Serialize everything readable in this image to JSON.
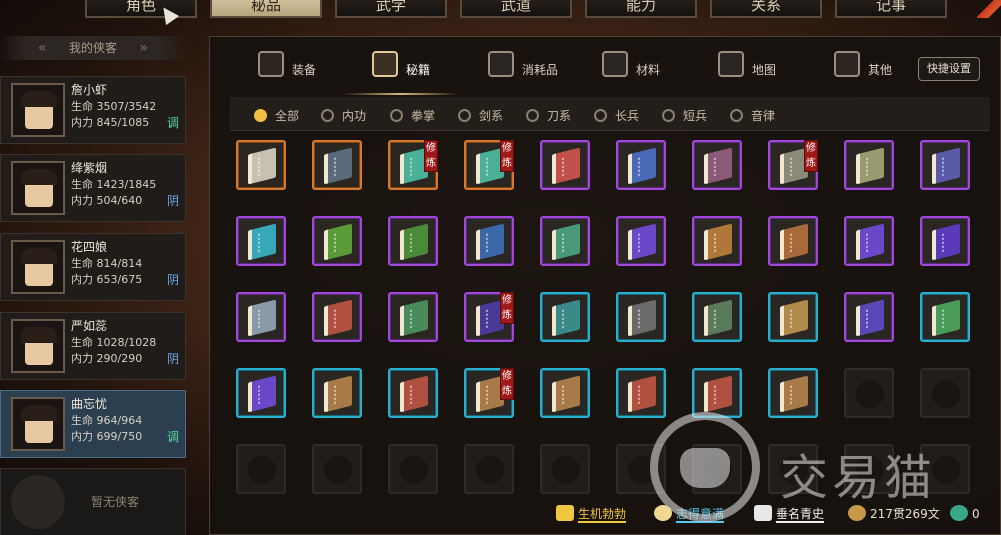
{
  "top_tabs": [
    {
      "label": "角色",
      "active": false
    },
    {
      "label": "秘品",
      "active": true
    },
    {
      "label": "武学",
      "active": false
    },
    {
      "label": "武道",
      "active": false
    },
    {
      "label": "能力",
      "active": false
    },
    {
      "label": "关系",
      "active": false
    },
    {
      "label": "记事",
      "active": false
    }
  ],
  "left": {
    "header": "我的侠客",
    "characters": [
      {
        "name": "詹小虾",
        "hp": "生命 3507/3542",
        "mp": "内力 845/1085",
        "yinyang": "调",
        "yy_color": "#5ad8a0",
        "selected": false
      },
      {
        "name": "绛紫烟",
        "hp": "生命 1423/1845",
        "mp": "内力 504/640",
        "yinyang": "阴",
        "yy_color": "#6aa8e8",
        "selected": false
      },
      {
        "name": "花四娘",
        "hp": "生命 814/814",
        "mp": "内力 653/675",
        "yinyang": "阴",
        "yy_color": "#6aa8e8",
        "selected": false
      },
      {
        "name": "严如蕊",
        "hp": "生命 1028/1028",
        "mp": "内力 290/290",
        "yinyang": "阴",
        "yy_color": "#6aa8e8",
        "selected": false
      },
      {
        "name": "曲忘忧",
        "hp": "生命 964/964",
        "mp": "内力 699/750",
        "yinyang": "调",
        "yy_color": "#5ad8a0",
        "selected": true
      }
    ],
    "empty_label": "暂无侠客"
  },
  "categories": [
    {
      "label": "装备",
      "icon": "armor-icon",
      "active": false
    },
    {
      "label": "秘籍",
      "icon": "manual-icon",
      "active": true
    },
    {
      "label": "消耗品",
      "icon": "potion-icon",
      "active": false
    },
    {
      "label": "材料",
      "icon": "herb-icon",
      "active": false
    },
    {
      "label": "地图",
      "icon": "map-icon",
      "active": false
    },
    {
      "label": "其他",
      "icon": "lamp-icon",
      "active": false
    }
  ],
  "quick_settings": "快捷设置",
  "filters": [
    {
      "label": "全部",
      "on": true
    },
    {
      "label": "内功",
      "on": false
    },
    {
      "label": "拳掌",
      "on": false
    },
    {
      "label": "剑系",
      "on": false
    },
    {
      "label": "刀系",
      "on": false
    },
    {
      "label": "长兵",
      "on": false
    },
    {
      "label": "短兵",
      "on": false
    },
    {
      "label": "音律",
      "on": false
    }
  ],
  "xiulian_label": "修炼",
  "inventory": [
    {
      "rarity": "orange",
      "color": "#c8c0b0",
      "xl": false
    },
    {
      "rarity": "orange",
      "color": "#5a6a7a",
      "xl": false
    },
    {
      "rarity": "orange",
      "color": "#4ab098",
      "xl": true
    },
    {
      "rarity": "orange",
      "color": "#4ab098",
      "xl": true
    },
    {
      "rarity": "purple",
      "color": "#c0504a",
      "xl": false
    },
    {
      "rarity": "purple",
      "color": "#4a6ab8",
      "xl": false
    },
    {
      "rarity": "purple",
      "color": "#8a5a78",
      "xl": false
    },
    {
      "rarity": "purple",
      "color": "#8a8a78",
      "xl": true
    },
    {
      "rarity": "purple",
      "color": "#9a9a70",
      "xl": false
    },
    {
      "rarity": "purple",
      "color": "#5a5aa8",
      "xl": false
    },
    {
      "rarity": "purple",
      "color": "#38a8b8",
      "xl": false
    },
    {
      "rarity": "purple",
      "color": "#5a9a38",
      "xl": false
    },
    {
      "rarity": "purple",
      "color": "#4a8a38",
      "xl": false
    },
    {
      "rarity": "purple",
      "color": "#3a68a8",
      "xl": false
    },
    {
      "rarity": "purple",
      "color": "#4a9a78",
      "xl": false
    },
    {
      "rarity": "purple",
      "color": "#6a48c8",
      "xl": false
    },
    {
      "rarity": "purple",
      "color": "#b07838",
      "xl": false
    },
    {
      "rarity": "purple",
      "color": "#a86a3a",
      "xl": false
    },
    {
      "rarity": "purple",
      "color": "#6a48c8",
      "xl": false
    },
    {
      "rarity": "purple",
      "color": "#5a3ab8",
      "xl": false
    },
    {
      "rarity": "purple",
      "color": "#8a9aa8",
      "xl": false
    },
    {
      "rarity": "purple",
      "color": "#b05040",
      "xl": false
    },
    {
      "rarity": "purple",
      "color": "#4a8a5a",
      "xl": false
    },
    {
      "rarity": "purple",
      "color": "#4a3a98",
      "xl": true
    },
    {
      "rarity": "cyan",
      "color": "#3a8a8a",
      "xl": false
    },
    {
      "rarity": "cyan",
      "color": "#6a6a68",
      "xl": false
    },
    {
      "rarity": "cyan",
      "color": "#5a7a5a",
      "xl": false
    },
    {
      "rarity": "cyan",
      "color": "#b08a48",
      "xl": false
    },
    {
      "rarity": "purple",
      "color": "#5a48b8",
      "xl": false
    },
    {
      "rarity": "cyan",
      "color": "#4a9a58",
      "xl": false
    },
    {
      "rarity": "cyan",
      "color": "#6a48c8",
      "xl": false
    },
    {
      "rarity": "cyan",
      "color": "#a87a48",
      "xl": false
    },
    {
      "rarity": "cyan",
      "color": "#b05040",
      "xl": false
    },
    {
      "rarity": "cyan",
      "color": "#a87a48",
      "xl": true
    },
    {
      "rarity": "cyan",
      "color": "#a87a48",
      "xl": false
    },
    {
      "rarity": "cyan",
      "color": "#b05040",
      "xl": false
    },
    {
      "rarity": "cyan",
      "color": "#b05040",
      "xl": false
    },
    {
      "rarity": "cyan",
      "color": "#a87a48",
      "xl": false
    },
    {
      "rarity": "empty",
      "color": "",
      "xl": false
    },
    {
      "rarity": "empty",
      "color": "",
      "xl": false
    },
    {
      "rarity": "empty",
      "color": "",
      "xl": false
    },
    {
      "rarity": "empty",
      "color": "",
      "xl": false
    },
    {
      "rarity": "empty",
      "color": "",
      "xl": false
    },
    {
      "rarity": "empty",
      "color": "",
      "xl": false
    },
    {
      "rarity": "empty",
      "color": "",
      "xl": false
    },
    {
      "rarity": "empty",
      "color": "",
      "xl": false
    },
    {
      "rarity": "empty",
      "color": "",
      "xl": false
    },
    {
      "rarity": "empty",
      "color": "",
      "xl": false
    },
    {
      "rarity": "empty",
      "color": "",
      "xl": false
    },
    {
      "rarity": "empty",
      "color": "",
      "xl": false
    }
  ],
  "status": [
    {
      "label": "生机勃勃",
      "color": "#f0c840",
      "icon": "vitality-icon"
    },
    {
      "label": "志得意满",
      "color": "#58c8f0",
      "icon": "mood-icon"
    },
    {
      "label": "垂名青史",
      "color": "#f0f0f0",
      "icon": "fame-icon"
    },
    {
      "label": "217贯269文",
      "color": "#e8e0d0",
      "icon": "coin-icon"
    },
    {
      "label": "0",
      "color": "#e8e0d0",
      "icon": "jade-icon"
    }
  ],
  "watermark": "交易猫"
}
